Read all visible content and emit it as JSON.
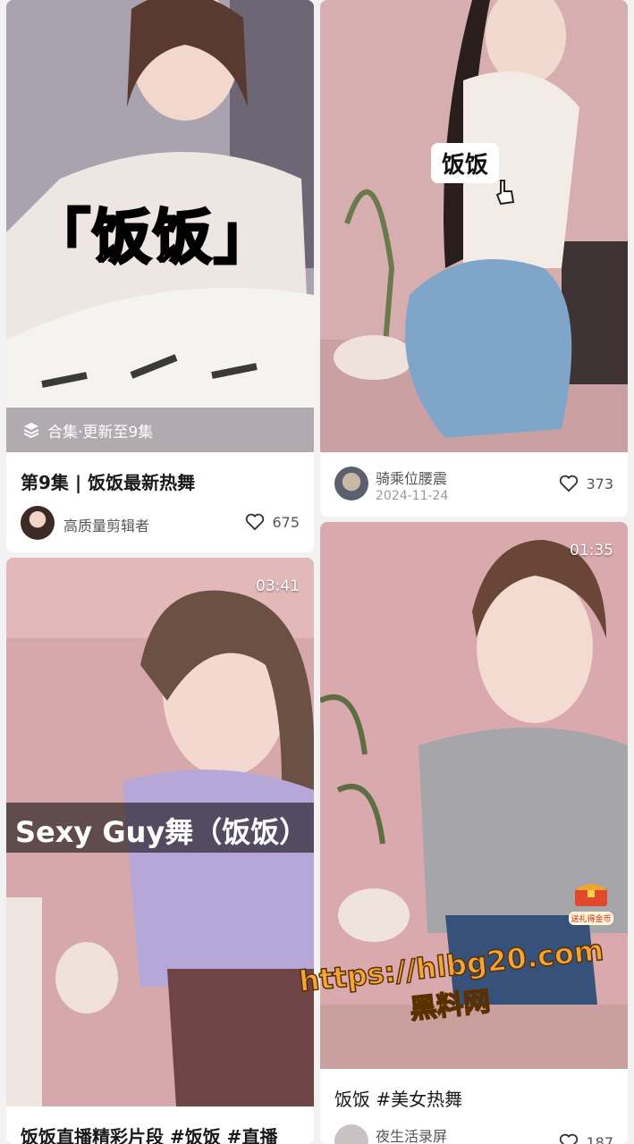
{
  "cards": [
    {
      "overlay_caption": "「饭饭」",
      "collection_label": "合集·更新至9集",
      "title": "第9集 | 饭饭最新热舞",
      "author": "高质量剪辑者",
      "likes": "675"
    },
    {
      "overlay_caption": "饭饭",
      "author": "骑乘位腰震",
      "date": "2024-11-24",
      "likes": "373"
    },
    {
      "duration": "03:41",
      "overlay_caption": "Sexy Guy舞（饭饭）",
      "title": "饭饭直播精彩片段 #饭饭 #直播"
    },
    {
      "duration": "01:35",
      "badge": "送礼得金币",
      "title": "饭饭 #美女热舞",
      "author": "夜生活录屏",
      "likes": "187"
    }
  ],
  "watermark": {
    "url": "https://hlbg20.com",
    "site": "黑料网"
  },
  "colors": {
    "background": "#f2f2f2",
    "card": "#ffffff",
    "thumb_pink": "#d9a9ad",
    "watermark_orange": "#f3a53a"
  }
}
